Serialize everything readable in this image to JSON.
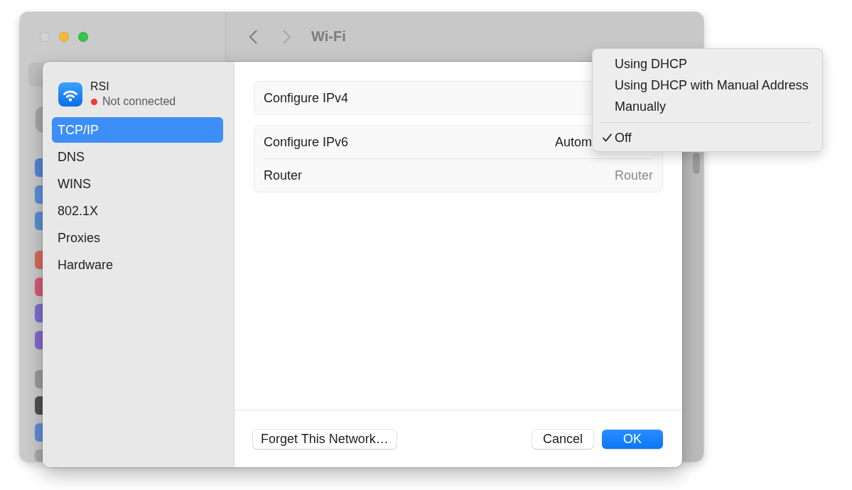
{
  "background_window": {
    "window_controls": [
      {
        "kind": "close",
        "disabled": true
      },
      {
        "kind": "minimize",
        "disabled": false
      },
      {
        "kind": "zoom",
        "disabled": false
      }
    ],
    "back_disabled": false,
    "forward_disabled": true,
    "title": "Wi-Fi",
    "sidebar_icon_groups": [
      {
        "icons": [
          {
            "color": "#5287d6"
          },
          {
            "color": "#5b8fdc"
          },
          {
            "color": "#5a8fd8"
          }
        ]
      },
      {
        "icons": [
          {
            "color": "#d86b5c"
          },
          {
            "color": "#d95a78"
          },
          {
            "color": "#7a6fd0"
          },
          {
            "color": "#8668cc"
          }
        ]
      },
      {
        "icons": [
          {
            "color": "#9c9c9c"
          },
          {
            "color": "#4f4f4f"
          },
          {
            "color": "#5d8fd6"
          },
          {
            "color": "#a9a9a9"
          }
        ]
      }
    ]
  },
  "dialog": {
    "network": {
      "name": "RSI",
      "status": "Not connected",
      "connected": false
    },
    "sidebar": {
      "items": [
        {
          "label": "TCP/IP",
          "selected": true
        },
        {
          "label": "DNS",
          "selected": false
        },
        {
          "label": "WINS",
          "selected": false
        },
        {
          "label": "802.1X",
          "selected": false
        },
        {
          "label": "Proxies",
          "selected": false
        },
        {
          "label": "Hardware",
          "selected": false
        }
      ]
    },
    "groups": [
      {
        "rows": [
          {
            "kind": "popup",
            "label": "Configure IPv4"
          }
        ]
      },
      {
        "rows": [
          {
            "kind": "popup",
            "label": "Configure IPv6",
            "value": "Autom"
          },
          {
            "kind": "field",
            "label": "Router",
            "placeholder": "Router"
          }
        ]
      }
    ],
    "footer": {
      "left_buttons": [
        {
          "kind": "secondary",
          "label": "Forget This Network…"
        }
      ],
      "right_buttons": [
        {
          "kind": "secondary",
          "label": "Cancel"
        },
        {
          "kind": "primary",
          "label": "OK"
        }
      ]
    }
  },
  "popup_menu": {
    "items": [
      {
        "kind": "option",
        "label": "Using DHCP",
        "selected": false
      },
      {
        "kind": "option",
        "label": "Using DHCP with Manual Address",
        "selected": false
      },
      {
        "kind": "option",
        "label": "Manually",
        "selected": false
      },
      {
        "kind": "separator"
      },
      {
        "kind": "option",
        "label": "Off",
        "selected": true
      }
    ]
  }
}
